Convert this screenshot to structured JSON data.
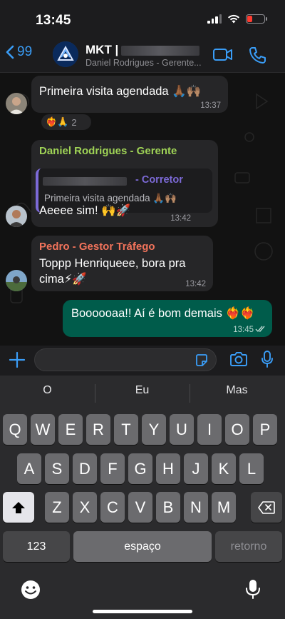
{
  "status_bar": {
    "time": "13:45"
  },
  "header": {
    "back_count": "99",
    "title": "MKT |",
    "subtitle": "Daniel Rodrigues - Gerente..."
  },
  "messages": [
    {
      "type": "in",
      "text": "Primeira visita agendada 🙏🏾🙌🏽",
      "time": "13:37",
      "reactions": "❤️‍🔥🙏",
      "reaction_count": "2"
    },
    {
      "type": "in",
      "sender": "Daniel Rodrigues - Gerente",
      "sender_color": "#9fd356",
      "quote_sender": "- Corretor",
      "quote_text": "Primeira visita agendada 🙏🏾🙌🏽",
      "text": "Aeeee sim! 🙌🚀",
      "time": "13:42"
    },
    {
      "type": "in",
      "sender": "Pedro - Gestor Tráfego",
      "sender_color": "#f2735b",
      "text": "Toppp Henriqueee, bora pra cima⚡🚀",
      "time": "13:42"
    },
    {
      "type": "out",
      "text": "Boooooaa!! Aí é bom demais ❤️‍🔥❤️‍🔥",
      "time": "13:45"
    }
  ],
  "input": {
    "placeholder": ""
  },
  "keyboard": {
    "suggestions": [
      "O",
      "Eu",
      "Mas"
    ],
    "row1": [
      "Q",
      "W",
      "E",
      "R",
      "T",
      "Y",
      "U",
      "I",
      "O",
      "P"
    ],
    "row2": [
      "A",
      "S",
      "D",
      "F",
      "G",
      "H",
      "J",
      "K",
      "L"
    ],
    "row3": [
      "Z",
      "X",
      "C",
      "V",
      "B",
      "N",
      "M"
    ],
    "numbers_label": "123",
    "space_label": "espaço",
    "return_label": "retorno"
  },
  "colors": {
    "accent": "#3a9df7",
    "outgoing_bubble": "#005c4b",
    "incoming_bubble": "#262628"
  }
}
